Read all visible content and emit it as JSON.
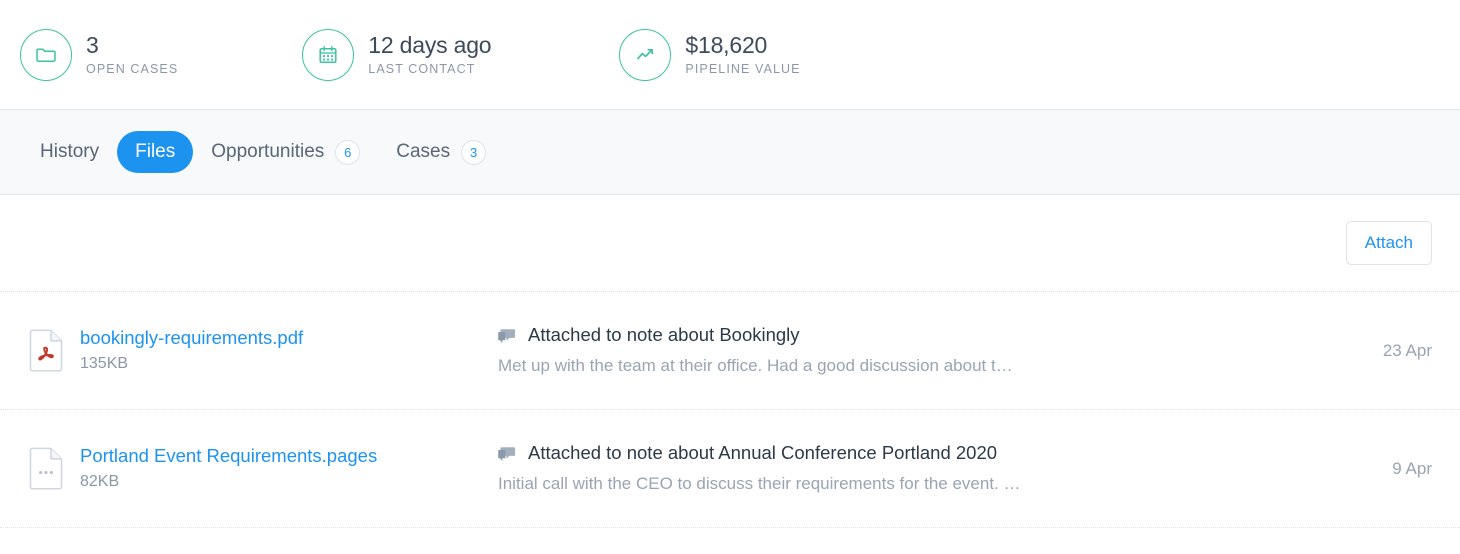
{
  "colors": {
    "accent_blue": "#1d93f0",
    "stat_ring_green": "#3cc3a0",
    "text_dark": "#2d3947",
    "text_muted": "#9aa4b2",
    "tabbar_bg": "#f7f9fb",
    "pdf_red": "#c0392b"
  },
  "stats": [
    {
      "icon": "folder-icon",
      "value": "3",
      "label": "OPEN CASES"
    },
    {
      "icon": "calendar-icon",
      "value": "12 days ago",
      "label": "LAST CONTACT"
    },
    {
      "icon": "trend-line-icon",
      "value": "$18,620",
      "label": "PIPELINE VALUE"
    }
  ],
  "tabs": [
    {
      "label": "History",
      "active": false,
      "badge": null
    },
    {
      "label": "Files",
      "active": true,
      "badge": null
    },
    {
      "label": "Opportunities",
      "active": false,
      "badge": "6"
    },
    {
      "label": "Cases",
      "active": false,
      "badge": "3"
    }
  ],
  "toolbar": {
    "attach_label": "Attach"
  },
  "files": [
    {
      "icon": "pdf-file-icon",
      "name": "bookingly-requirements.pdf",
      "size": "135KB",
      "note_icon": "comment-icon",
      "note_title": "Attached to note about Bookingly",
      "note_preview": "Met up with the team at their office. Had a good discussion about t…",
      "date": "23 Apr"
    },
    {
      "icon": "generic-file-icon",
      "name": "Portland Event Requirements.pages",
      "size": "82KB",
      "note_icon": "comment-icon",
      "note_title": "Attached to note about Annual Conference Portland 2020",
      "note_preview": "Initial call with the CEO to discuss their requirements for the event. …",
      "date": "9 Apr"
    }
  ]
}
